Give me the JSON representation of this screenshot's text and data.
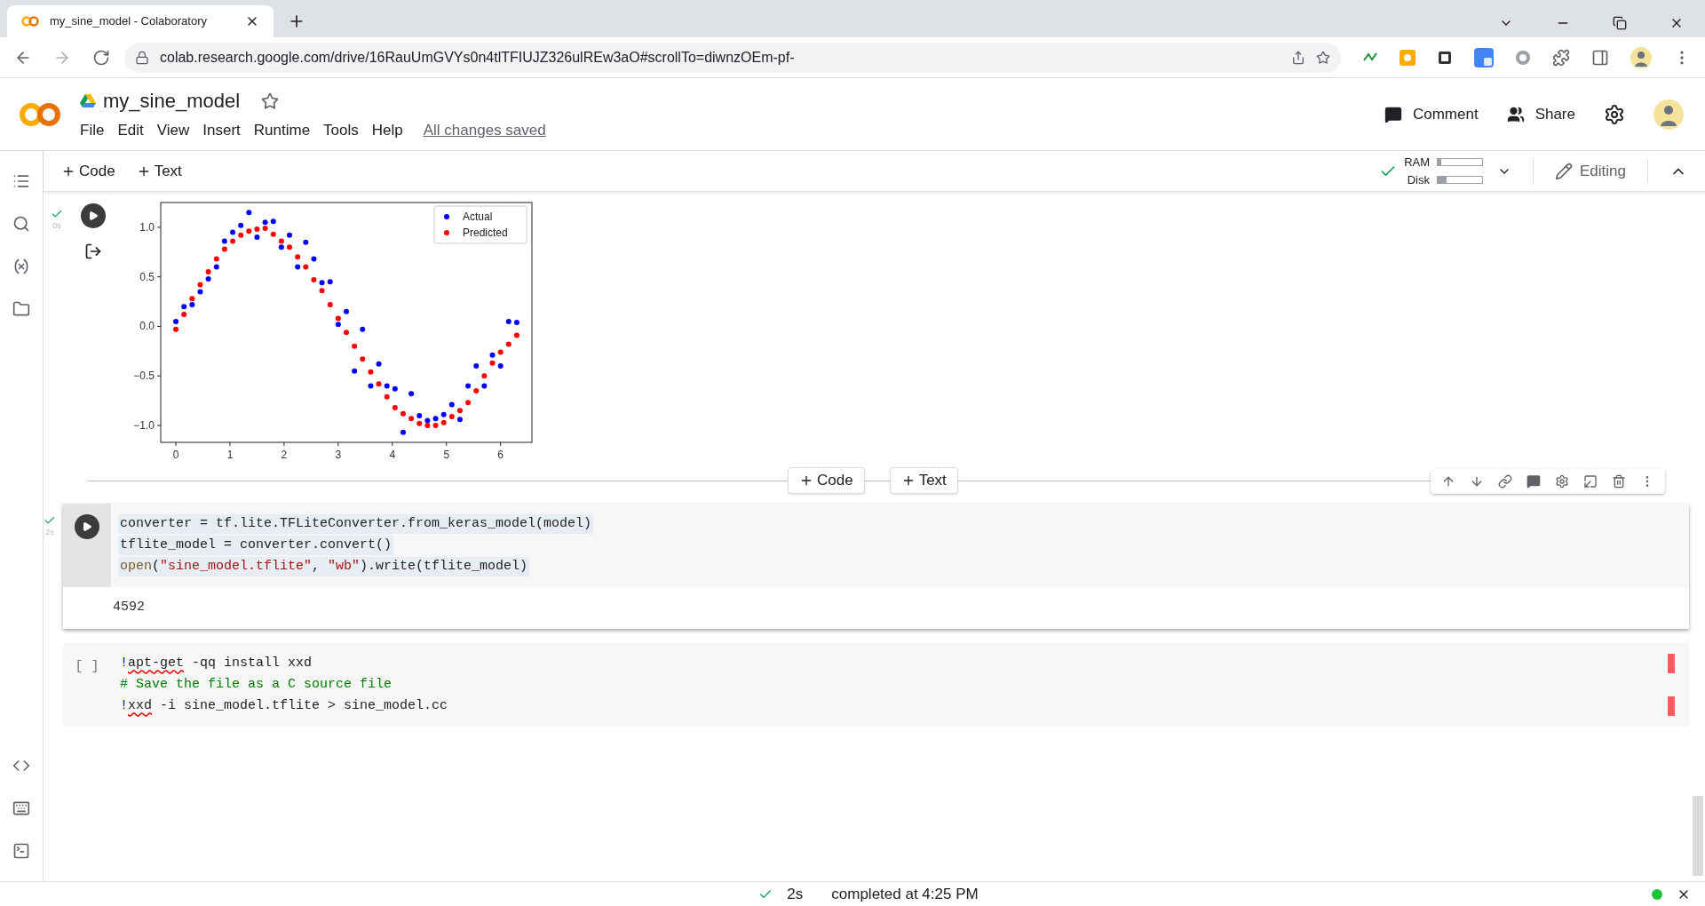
{
  "browser": {
    "tab_title": "my_sine_model - Colaboratory",
    "url": "colab.research.google.com/drive/16RauUmGVYs0n4tlTFIUJZ326ulREw3aO#scrollTo=diwnzOEm-pf-"
  },
  "header": {
    "notebook_name": "my_sine_model",
    "menu": [
      "File",
      "Edit",
      "View",
      "Insert",
      "Runtime",
      "Tools",
      "Help"
    ],
    "save_status": "All changes saved",
    "comment": "Comment",
    "share": "Share"
  },
  "toolbar": {
    "add_code": "Code",
    "add_text": "Text",
    "ram_label": "RAM",
    "disk_label": "Disk",
    "ram": {
      "level": 0.08
    },
    "disk": {
      "level": 0.2
    },
    "mode": "Editing"
  },
  "cells": [
    {
      "kind": "output",
      "time": "0s",
      "chart_data": {
        "type": "scatter",
        "x": [
          0,
          0.15,
          0.3,
          0.45,
          0.6,
          0.75,
          0.9,
          1.05,
          1.2,
          1.35,
          1.5,
          1.65,
          1.8,
          1.95,
          2.1,
          2.25,
          2.4,
          2.55,
          2.7,
          2.85,
          3.0,
          3.15,
          3.3,
          3.45,
          3.6,
          3.75,
          3.9,
          4.05,
          4.2,
          4.35,
          4.5,
          4.65,
          4.8,
          4.95,
          5.1,
          5.25,
          5.4,
          5.55,
          5.7,
          5.85,
          6.0,
          6.15,
          6.3
        ],
        "xlim": [
          -0.28,
          6.58
        ],
        "ylim": [
          -1.17,
          1.25
        ],
        "xticks": [
          0,
          1,
          2,
          3,
          4,
          5,
          6
        ],
        "legend": "upper right",
        "yticks": [
          {
            "value": 1,
            "label": "1.0"
          },
          {
            "value": 0.5,
            "label": "0.5"
          },
          {
            "value": 0,
            "label": "0.0"
          },
          {
            "value": -0.5,
            "label": "−0.5"
          },
          {
            "value": -1,
            "label": "−1.0"
          }
        ],
        "series": [
          {
            "name": "Actual",
            "color": "#0000ff",
            "values": [
              0.05,
              0.2,
              0.22,
              0.35,
              0.48,
              0.6,
              0.86,
              0.95,
              1.02,
              1.15,
              0.9,
              1.05,
              1.06,
              0.8,
              0.92,
              0.6,
              0.85,
              0.68,
              0.44,
              0.45,
              0.02,
              0.15,
              -0.45,
              -0.03,
              -0.6,
              -0.38,
              -0.6,
              -0.63,
              -1.07,
              -0.68,
              -0.9,
              -0.95,
              -0.93,
              -0.89,
              -0.79,
              -0.94,
              -0.6,
              -0.4,
              -0.6,
              -0.29,
              -0.4,
              0.05,
              0.04
            ]
          },
          {
            "name": "Predicted",
            "color": "#ff0000",
            "values": [
              -0.03,
              0.12,
              0.28,
              0.42,
              0.55,
              0.68,
              0.78,
              0.86,
              0.92,
              0.96,
              0.98,
              0.99,
              0.93,
              0.86,
              0.8,
              0.7,
              0.6,
              0.47,
              0.36,
              0.22,
              0.08,
              -0.06,
              -0.2,
              -0.33,
              -0.46,
              -0.58,
              -0.71,
              -0.82,
              -0.88,
              -0.93,
              -0.98,
              -1.0,
              -1.0,
              -0.97,
              -0.91,
              -0.85,
              -0.77,
              -0.65,
              -0.5,
              -0.37,
              -0.26,
              -0.18,
              -0.09
            ]
          }
        ]
      }
    },
    {
      "kind": "code",
      "time": "2s",
      "selected": true,
      "lines": [
        {
          "marked": false,
          "tokens": [
            {
              "kind": "plain",
              "text": "converter = tf.lite.TFLiteConverter.from_keras_model(model)"
            }
          ]
        },
        {
          "marked": false,
          "tokens": [
            {
              "kind": "plain",
              "text": "tflite_model = converter.convert()"
            }
          ]
        },
        {
          "marked": false,
          "tokens": [
            {
              "kind": "builtin",
              "text": "open"
            },
            {
              "kind": "plain",
              "text": "("
            },
            {
              "kind": "string",
              "text": "\"sine_model.tflite\""
            },
            {
              "kind": "plain",
              "text": ", "
            },
            {
              "kind": "string",
              "text": "\"wb\""
            },
            {
              "kind": "plain",
              "text": ").write(tflite_model)"
            }
          ]
        }
      ],
      "output": "4592"
    },
    {
      "kind": "code",
      "prompt": "[ ]",
      "selected": false,
      "lines": [
        {
          "marked": true,
          "tokens": [
            {
              "kind": "shell",
              "text": "!"
            },
            {
              "kind": "error",
              "text": "apt-get"
            },
            {
              "kind": "plain",
              "text": " -qq install xxd"
            }
          ]
        },
        {
          "marked": false,
          "tokens": [
            {
              "kind": "comment",
              "text": "# Save the file as a C source file"
            }
          ]
        },
        {
          "marked": true,
          "tokens": [
            {
              "kind": "shell",
              "text": "!"
            },
            {
              "kind": "error",
              "text": "xxd"
            },
            {
              "kind": "plain",
              "text": " -i sine_model.tflite > sine_model.cc"
            }
          ]
        }
      ]
    }
  ],
  "insert_buttons": {
    "code": "Code",
    "text": "Text"
  },
  "status_bar": {
    "time": "2s",
    "message": "completed at 4:25 PM",
    "connected": true
  }
}
